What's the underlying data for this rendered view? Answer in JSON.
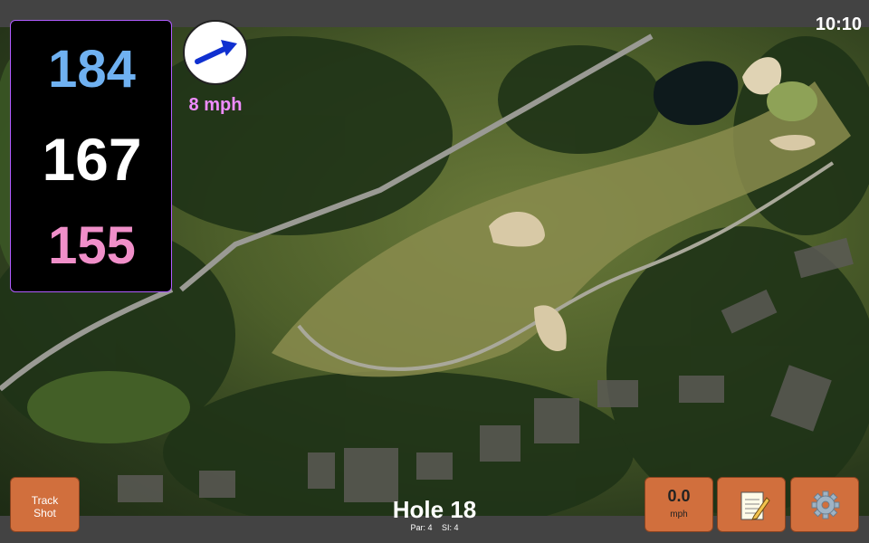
{
  "status": {
    "time": "10:10"
  },
  "yardage": {
    "back": "184",
    "middle": "167",
    "front": "155"
  },
  "wind": {
    "speed_label": "8 mph",
    "direction_icon": "wind-direction-arrow-icon"
  },
  "hole": {
    "title": "Hole 18",
    "par": "Par: 4",
    "si": "SI: 4"
  },
  "buttons": {
    "track_shot": {
      "line1": "Track",
      "line2": "Shot"
    },
    "wind_readout": {
      "value": "0.0",
      "unit": "mph"
    },
    "notes_icon": "notepad-icon",
    "settings_icon": "gear-icon"
  },
  "colors": {
    "back_yardage": "#6fb1f1",
    "middle_yardage": "#ffffff",
    "front_yardage": "#f08fc9",
    "wind_text": "#ef8cff",
    "button_orange": "#d16f3d",
    "panel_border": "#b05cff"
  }
}
